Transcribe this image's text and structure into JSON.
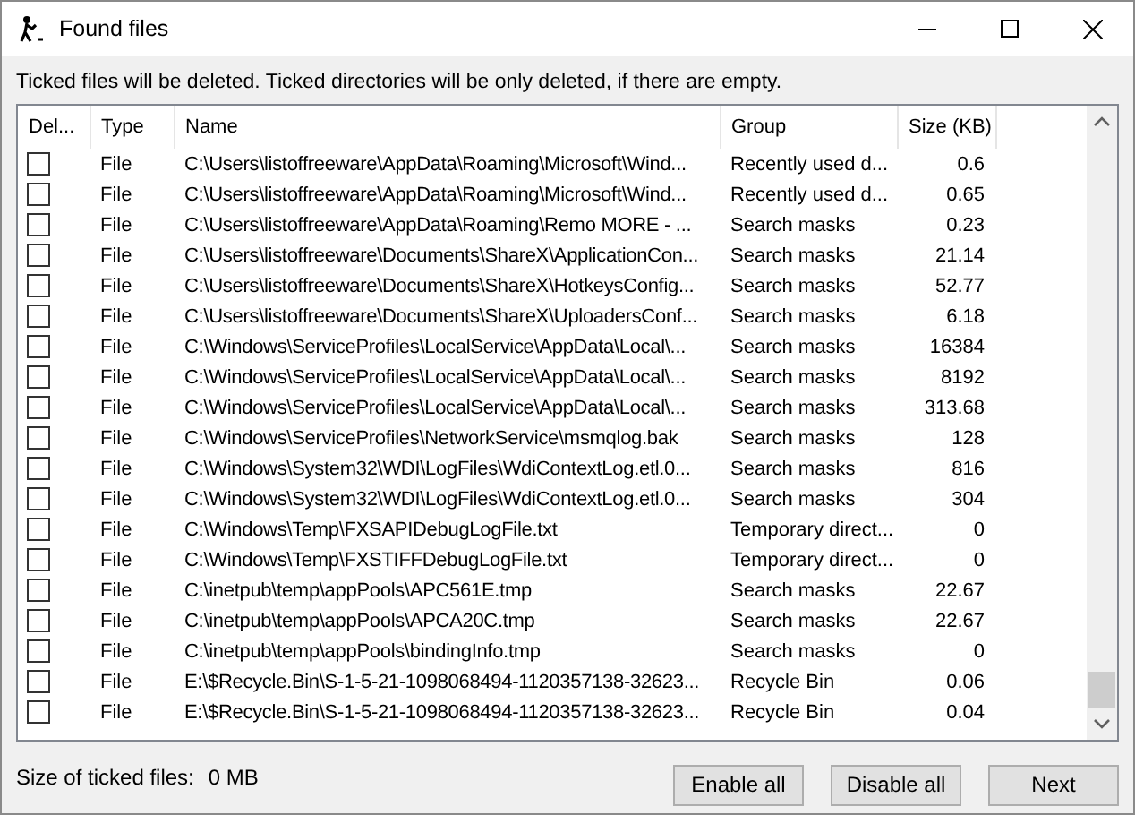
{
  "window": {
    "title": "Found files"
  },
  "info": "Ticked files will be deleted. Ticked directories will be only deleted, if there are empty.",
  "table": {
    "columns": [
      "Del...",
      "Type",
      "Name",
      "Group",
      "Size (KB)"
    ],
    "rows": [
      {
        "checked": false,
        "type": "File",
        "name": "C:\\Users\\listoffreeware\\AppData\\Roaming\\Microsoft\\Wind...",
        "group": "Recently used d...",
        "size": "0.6"
      },
      {
        "checked": false,
        "type": "File",
        "name": "C:\\Users\\listoffreeware\\AppData\\Roaming\\Microsoft\\Wind...",
        "group": "Recently used d...",
        "size": "0.65"
      },
      {
        "checked": false,
        "type": "File",
        "name": "C:\\Users\\listoffreeware\\AppData\\Roaming\\Remo MORE - ...",
        "group": "Search masks",
        "size": "0.23"
      },
      {
        "checked": false,
        "type": "File",
        "name": "C:\\Users\\listoffreeware\\Documents\\ShareX\\ApplicationCon...",
        "group": "Search masks",
        "size": "21.14"
      },
      {
        "checked": false,
        "type": "File",
        "name": "C:\\Users\\listoffreeware\\Documents\\ShareX\\HotkeysConfig...",
        "group": "Search masks",
        "size": "52.77"
      },
      {
        "checked": false,
        "type": "File",
        "name": "C:\\Users\\listoffreeware\\Documents\\ShareX\\UploadersConf...",
        "group": "Search masks",
        "size": "6.18"
      },
      {
        "checked": false,
        "type": "File",
        "name": "C:\\Windows\\ServiceProfiles\\LocalService\\AppData\\Local\\...",
        "group": "Search masks",
        "size": "16384"
      },
      {
        "checked": false,
        "type": "File",
        "name": "C:\\Windows\\ServiceProfiles\\LocalService\\AppData\\Local\\...",
        "group": "Search masks",
        "size": "8192"
      },
      {
        "checked": false,
        "type": "File",
        "name": "C:\\Windows\\ServiceProfiles\\LocalService\\AppData\\Local\\...",
        "group": "Search masks",
        "size": "313.68"
      },
      {
        "checked": false,
        "type": "File",
        "name": "C:\\Windows\\ServiceProfiles\\NetworkService\\msmqlog.bak",
        "group": "Search masks",
        "size": "128"
      },
      {
        "checked": false,
        "type": "File",
        "name": "C:\\Windows\\System32\\WDI\\LogFiles\\WdiContextLog.etl.0...",
        "group": "Search masks",
        "size": "816"
      },
      {
        "checked": false,
        "type": "File",
        "name": "C:\\Windows\\System32\\WDI\\LogFiles\\WdiContextLog.etl.0...",
        "group": "Search masks",
        "size": "304"
      },
      {
        "checked": false,
        "type": "File",
        "name": "C:\\Windows\\Temp\\FXSAPIDebugLogFile.txt",
        "group": "Temporary direct...",
        "size": "0"
      },
      {
        "checked": false,
        "type": "File",
        "name": "C:\\Windows\\Temp\\FXSTIFFDebugLogFile.txt",
        "group": "Temporary direct...",
        "size": "0"
      },
      {
        "checked": false,
        "type": "File",
        "name": "C:\\inetpub\\temp\\appPools\\APC561E.tmp",
        "group": "Search masks",
        "size": "22.67"
      },
      {
        "checked": false,
        "type": "File",
        "name": "C:\\inetpub\\temp\\appPools\\APCA20C.tmp",
        "group": "Search masks",
        "size": "22.67"
      },
      {
        "checked": false,
        "type": "File",
        "name": "C:\\inetpub\\temp\\appPools\\bindingInfo.tmp",
        "group": "Search masks",
        "size": "0"
      },
      {
        "checked": false,
        "type": "File",
        "name": "E:\\$Recycle.Bin\\S-1-5-21-1098068494-1120357138-32623...",
        "group": "Recycle Bin",
        "size": "0.06"
      },
      {
        "checked": false,
        "type": "File",
        "name": "E:\\$Recycle.Bin\\S-1-5-21-1098068494-1120357138-32623...",
        "group": "Recycle Bin",
        "size": "0.04"
      }
    ]
  },
  "status": {
    "label": "Size of ticked files:",
    "value": "0 MB"
  },
  "buttons": [
    "Enable all",
    "Disable all",
    "Next"
  ]
}
